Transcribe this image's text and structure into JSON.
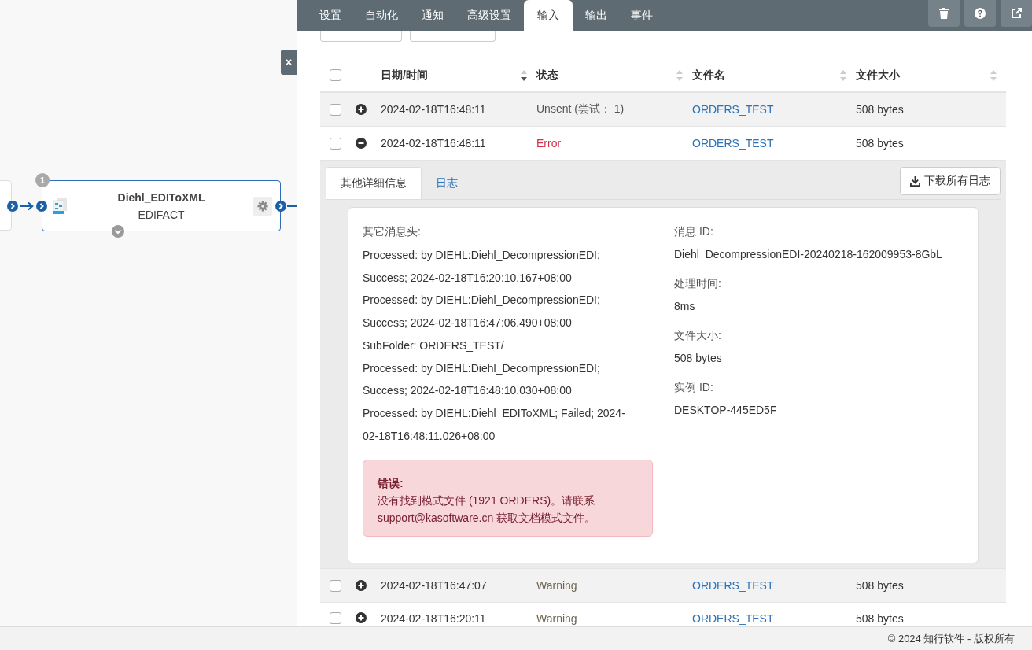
{
  "canvas": {
    "close_button": "×",
    "node": {
      "badge": "1",
      "title": "Diehl_EDIToXML",
      "subtitle": "EDIFACT"
    }
  },
  "tabs": [
    {
      "label": "设置",
      "selected": false
    },
    {
      "label": "自动化",
      "selected": false
    },
    {
      "label": "通知",
      "selected": false
    },
    {
      "label": "高级设置",
      "selected": false
    },
    {
      "label": "输入",
      "selected": true
    },
    {
      "label": "输出",
      "selected": false
    },
    {
      "label": "事件",
      "selected": false
    }
  ],
  "table": {
    "columns": [
      {
        "label": "日期/时间",
        "sorted": true
      },
      {
        "label": "状态",
        "sorted": false
      },
      {
        "label": "文件名",
        "sorted": false
      },
      {
        "label": "文件大小",
        "sorted": false
      }
    ],
    "header_checked": false,
    "rows": [
      {
        "checked": false,
        "expanded": false,
        "date": "2024-02-18T16:48:11",
        "status": "Unsent (尝试： 1)",
        "kind": "unsent",
        "file": "ORDERS_TEST",
        "size": "508 bytes"
      },
      {
        "checked": false,
        "expanded": true,
        "date": "2024-02-18T16:48:11",
        "status": "Error",
        "kind": "error",
        "file": "ORDERS_TEST",
        "size": "508 bytes"
      },
      {
        "checked": false,
        "expanded": false,
        "date": "2024-02-18T16:47:07",
        "status": "Warning",
        "kind": "warning",
        "file": "ORDERS_TEST",
        "size": "508 bytes"
      },
      {
        "checked": false,
        "expanded": false,
        "date": "2024-02-18T16:20:11",
        "status": "Warning",
        "kind": "warning",
        "file": "ORDERS_TEST",
        "size": "508 bytes"
      }
    ]
  },
  "details": {
    "tabs": [
      {
        "label": "其他详细信息",
        "selected": true
      },
      {
        "label": "日志",
        "selected": false
      }
    ],
    "download_button": "下载所有日志",
    "headers_label": "其它消息头:",
    "headers_lines": [
      "Processed: by DIEHL:Diehl_DecompressionEDI;",
      "Success; 2024-02-18T16:20:10.167+08:00",
      "Processed: by DIEHL:Diehl_DecompressionEDI;",
      "Success; 2024-02-18T16:47:06.490+08:00",
      "SubFolder: ORDERS_TEST/",
      "Processed: by DIEHL:Diehl_DecompressionEDI;",
      "Success; 2024-02-18T16:48:10.030+08:00",
      "Processed: by DIEHL:Diehl_EDIToXML; Failed; 2024-",
      "02-18T16:48:11.026+08:00"
    ],
    "fields": [
      {
        "label": "消息 ID:",
        "value": "Diehl_DecompressionEDI-20240218-162009953-8GbL"
      },
      {
        "label": "处理时间:",
        "value": "8ms"
      },
      {
        "label": "文件大小:",
        "value": "508 bytes"
      },
      {
        "label": "实例 ID:",
        "value": "DESKTOP-445ED5F"
      }
    ],
    "error": {
      "title": "错误:",
      "text": "没有找到模式文件 (1921 ORDERS)。请联系 support@kasoftware.cn 获取文档模式文件。"
    }
  },
  "footer": "© 2024 知行软件 - 版权所有"
}
